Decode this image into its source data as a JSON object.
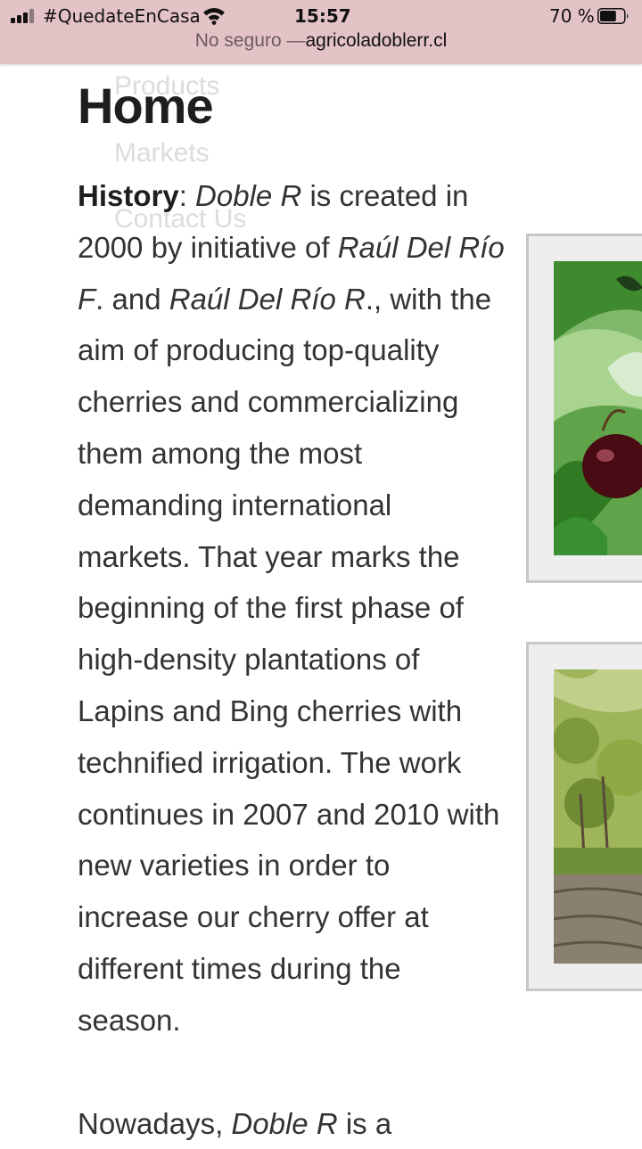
{
  "status_bar": {
    "carrier": "#QuedateEnCasa",
    "time": "15:57",
    "battery_percent": "70 %",
    "battery_level": 0.7
  },
  "address_bar": {
    "insecure_label": "No seguro —",
    "domain": "agricoladoblerr.cl"
  },
  "nav": {
    "items": [
      "Products",
      "Markets",
      "Contact Us"
    ]
  },
  "page": {
    "title": "Home",
    "history_label": "History",
    "history_text": [
      {
        "t": ": ",
        "i": false
      },
      {
        "t": "Doble R",
        "i": true
      },
      {
        "t": " is created in 2000 by initiative of ",
        "i": false
      },
      {
        "t": "Raúl Del Río F",
        "i": true
      },
      {
        "t": ". and ",
        "i": false
      },
      {
        "t": "Raúl Del Río R",
        "i": true
      },
      {
        "t": "., with the aim of producing top-quality cherries and commercializing them among the most demanding international markets. That year marks the beginning of the first phase of high-density plantations of Lapins and Bing cherries with technified irrigation. The work continues in 2007 and 2010 with new varieties in order to increase our cherry offer at different times during the season.",
        "i": false
      }
    ],
    "next_paragraph": [
      {
        "t": "Nowadays, ",
        "i": false
      },
      {
        "t": "Doble R",
        "i": true
      },
      {
        "t": " is a",
        "i": false
      }
    ]
  },
  "images": [
    {
      "name": "cherry-photo",
      "subject": "dark red cherry among green leaves"
    },
    {
      "name": "orchard-photo",
      "subject": "cherry orchard trees"
    }
  ]
}
